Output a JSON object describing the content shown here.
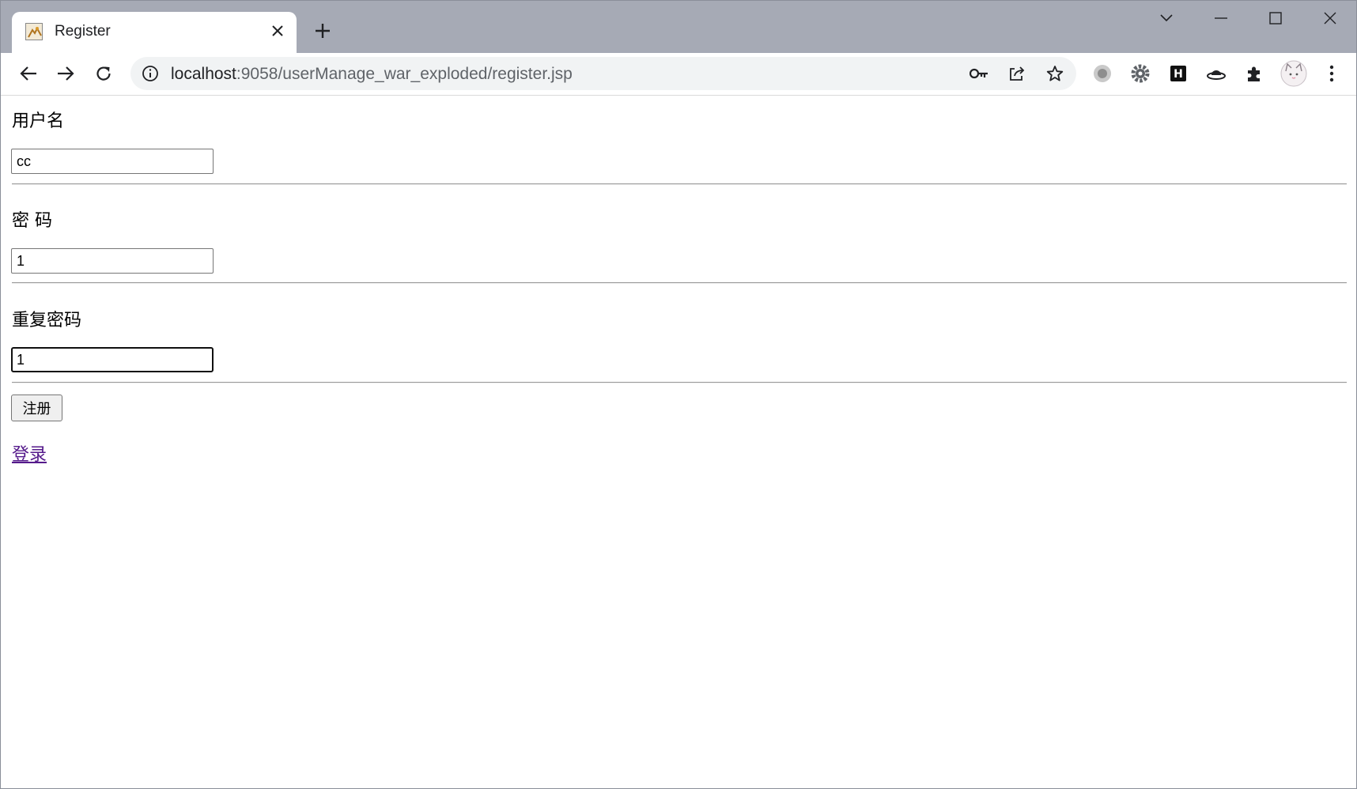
{
  "browser": {
    "tab_title": "Register",
    "url_host": "localhost",
    "url_rest": ":9058/userManage_war_exploded/register.jsp",
    "icons": {
      "favicon": "tomcat-favicon",
      "tab_close": "close-icon",
      "new_tab": "plus-icon",
      "tab_search": "chevron-down-icon",
      "minimize": "minimize-icon",
      "maximize": "maximize-icon",
      "close": "close-icon",
      "back": "back-arrow-icon",
      "forward": "forward-arrow-icon",
      "reload": "reload-icon",
      "site_info": "info-icon",
      "password": "key-icon",
      "share": "share-icon",
      "bookmark": "star-icon",
      "extensions": [
        "circle-extension-icon",
        "gear-extension-icon",
        "h-extension-icon",
        "hat-extension-icon",
        "puzzle-icon"
      ],
      "profile": "cat-avatar",
      "menu": "kebab-menu-icon"
    }
  },
  "form": {
    "username_label": "用户名",
    "username_value": "cc",
    "password_label": "密 码",
    "password_value": "1",
    "repeat_label": "重复密码",
    "repeat_value": "1",
    "submit_label": "注册",
    "login_link": "登录"
  }
}
